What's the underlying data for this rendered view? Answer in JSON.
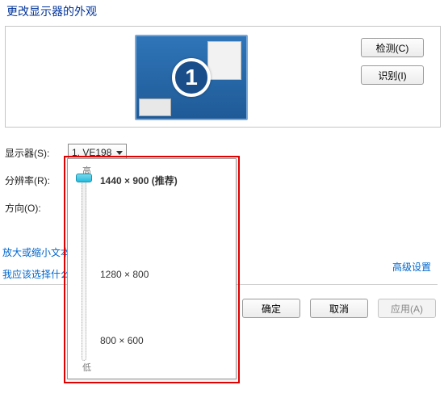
{
  "heading": "更改显示器的外观",
  "panel": {
    "monitor_number": "1",
    "detect_label": "检测(C)",
    "identify_label": "识别(I)"
  },
  "labels": {
    "display": "显示器(S):",
    "resolution": "分辨率(R):",
    "orientation": "方向(O):"
  },
  "display_select": {
    "value": "1. VE198"
  },
  "resolution_select": {
    "value": "1440 × 900 (推荐)"
  },
  "advanced_link": "高级设置",
  "left_links": {
    "resize": "放大或缩小文本",
    "help": "我应该选择什么"
  },
  "buttons": {
    "ok": "确定",
    "cancel": "取消",
    "apply": "应用(A)"
  },
  "res_popup": {
    "high": "高",
    "low": "低",
    "options": [
      "1440 × 900 (推荐)",
      "1280 × 800",
      "800 × 600"
    ]
  }
}
